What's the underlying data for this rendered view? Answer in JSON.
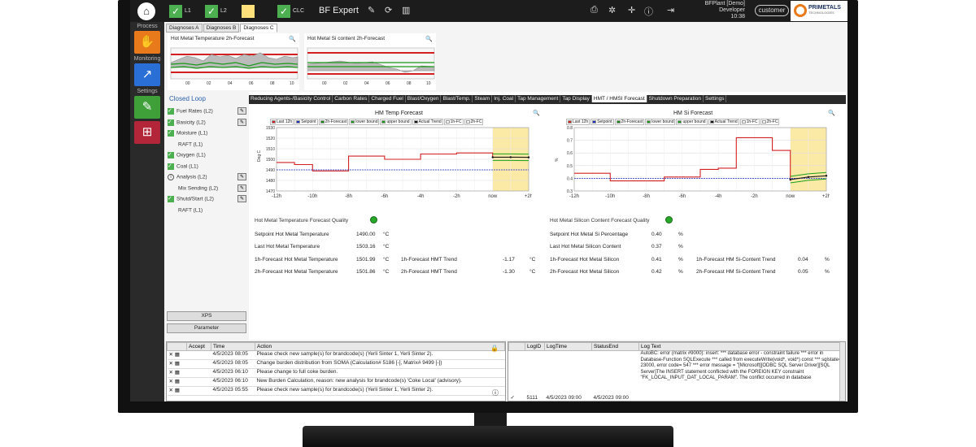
{
  "topbar": {
    "home_icon": "home-icon",
    "checks": [
      {
        "label": "L1"
      },
      {
        "label": "L2"
      },
      {
        "label": ""
      },
      {
        "label": "CLC"
      }
    ],
    "app_title": "BF Expert",
    "user_line1": "BFPlant [Demo]",
    "user_line2": "Developer",
    "time": "10:38",
    "customer": "customer",
    "brand": "PRIMETALS",
    "brand_sub": "TECHNOLOGIES"
  },
  "sidebar": {
    "sections": [
      {
        "label": "Process"
      },
      {
        "label": "Monitoring"
      },
      {
        "label": "Settings"
      }
    ],
    "colors": {
      "process": "#e97a1b",
      "monitoring": "#2a6fd6",
      "settings": "#3fa03a",
      "network": "#b3263a"
    }
  },
  "diag_tabs": [
    "Diagnoses A",
    "Diagnoses B",
    "Diagnoses C"
  ],
  "mini_charts": [
    {
      "title": "Hot Metal Temperature 2h-Forecast",
      "ticks": [
        "00",
        "02",
        "04",
        "06",
        "08",
        "10"
      ]
    },
    {
      "title": "Hot Metal Si content 2h-Forecast",
      "ticks": [
        "00",
        "02",
        "04",
        "06",
        "08",
        "10"
      ]
    }
  ],
  "closed_loop": {
    "title": "Closed Loop",
    "items": [
      {
        "label": "Fuel Rates (L2)",
        "state": "checked",
        "edit": true
      },
      {
        "label": "Basicity (L2)",
        "state": "checked",
        "edit": true
      },
      {
        "label": "Moisture (L1)",
        "state": "checked",
        "edit": false
      },
      {
        "label": "RAFT (L1)",
        "state": "none",
        "edit": false
      },
      {
        "label": "Oxygen (L1)",
        "state": "checked",
        "edit": false
      },
      {
        "label": "Coal (L1)",
        "state": "checked",
        "edit": false
      },
      {
        "label": "Analysis (L2)",
        "state": "info",
        "edit": true
      },
      {
        "label": "Mix Sending (L2)",
        "state": "none",
        "edit": true
      },
      {
        "label": "Shutd/Start (L2)",
        "state": "checked",
        "edit": true
      },
      {
        "label": "RAFT (L1)",
        "state": "none",
        "edit": false
      }
    ],
    "xps_label": "XPS",
    "parameter_label": "Parameter"
  },
  "main_tabs": [
    "Reducing Agents-/Basicity Control",
    "Carbon Rates",
    "Charged Fuel",
    "Blast/Oxygen",
    "Blast/Temp.",
    "Steam",
    "Inj. Coal",
    "Tap Management",
    "Tap Display",
    "HMT / HMSI Forecast",
    "Shutdown Preparation",
    "Settings"
  ],
  "main_tab_active": 9,
  "legend_items": [
    {
      "label": "Last 12h",
      "color": "#d32020"
    },
    {
      "label": "Setpoint",
      "color": "#2030c0"
    },
    {
      "label": "2h-Forecast",
      "color": "#1a8a1a"
    },
    {
      "label": "lower bound",
      "color": "#1aa01a"
    },
    {
      "label": "upper bound",
      "color": "#1aa01a"
    },
    {
      "label": "Actual Trend",
      "color": "#111111"
    },
    {
      "label": "1h-FC",
      "color": "#ffffff"
    },
    {
      "label": "2h-FC",
      "color": "#ffffff"
    }
  ],
  "charts": [
    {
      "title": "HM Temp Forecast",
      "ylabel": "Deg C",
      "yticks": [
        "1530",
        "1520",
        "1510",
        "1500",
        "1490",
        "1480",
        "1470"
      ],
      "xticks": [
        "-12h",
        "-10h",
        "-8h",
        "-6h",
        "-4h",
        "-2h",
        "now",
        "+2h"
      ]
    },
    {
      "title": "HM Si Forecast",
      "ylabel": "%",
      "yticks": [
        "0.8",
        "0.7",
        "0.6",
        "0.5",
        "0.4",
        "0.3"
      ],
      "xticks": [
        "-12h",
        "-10h",
        "-8h",
        "-6h",
        "-4h",
        "-2h",
        "now",
        "+2h"
      ]
    }
  ],
  "chart_data": [
    {
      "type": "line",
      "title": "HM Temp Forecast",
      "ylabel": "Deg C",
      "ylim": [
        1470,
        1530
      ],
      "x": [
        "-12h",
        "-11h",
        "-10h",
        "-9h",
        "-8h",
        "-7h",
        "-6h",
        "-5h",
        "-4h",
        "-3h",
        "-2h",
        "-1h",
        "now",
        "+1h",
        "+2h"
      ],
      "series": [
        {
          "name": "Last 12h",
          "values": [
            1497,
            1495,
            1489,
            1489,
            1503,
            1503,
            1500,
            1500,
            1505,
            1505,
            1506,
            1506,
            1501
          ]
        },
        {
          "name": "Setpoint",
          "values": [
            1490,
            1490,
            1490,
            1490,
            1490,
            1490,
            1490,
            1490,
            1490,
            1490,
            1490,
            1490,
            1490,
            1490,
            1490
          ]
        },
        {
          "name": "2h-Forecast",
          "values": [
            null,
            null,
            null,
            null,
            null,
            null,
            null,
            null,
            null,
            null,
            null,
            null,
            1502,
            1501.99,
            1501.86
          ]
        }
      ]
    },
    {
      "type": "line",
      "title": "HM Si Forecast",
      "ylabel": "%",
      "ylim": [
        0.3,
        0.8
      ],
      "x": [
        "-12h",
        "-11h",
        "-10h",
        "-9h",
        "-8h",
        "-7h",
        "-6h",
        "-5h",
        "-4h",
        "-3h",
        "-2h",
        "-1h",
        "now",
        "+1h",
        "+2h"
      ],
      "series": [
        {
          "name": "Last 12h",
          "values": [
            0.44,
            0.44,
            0.38,
            0.38,
            0.38,
            0.41,
            0.41,
            0.47,
            0.48,
            0.72,
            0.72,
            0.62,
            0.38
          ]
        },
        {
          "name": "Setpoint",
          "values": [
            0.4,
            0.4,
            0.4,
            0.4,
            0.4,
            0.4,
            0.4,
            0.4,
            0.4,
            0.4,
            0.4,
            0.4,
            0.4,
            0.4,
            0.4
          ]
        },
        {
          "name": "2h-Forecast",
          "values": [
            null,
            null,
            null,
            null,
            null,
            null,
            null,
            null,
            null,
            null,
            null,
            null,
            0.39,
            0.41,
            0.42
          ]
        }
      ]
    }
  ],
  "hmt": {
    "quality_label": "Hot Metal Temperature Forecast Quality",
    "rows": [
      {
        "label": "Setpoint Hot Metal Temperature",
        "value": "1490.00",
        "unit": "°C"
      },
      {
        "label": "Last Hot Metal Temperature",
        "value": "1503.16",
        "unit": "°C"
      },
      {
        "label": "1h-Forecast Hot Metal Temperature",
        "value": "1501.99",
        "unit": "°C",
        "trend_label": "1h-Forecast HMT Trend",
        "trend": "-1.17",
        "trend_unit": "°C"
      },
      {
        "label": "2h-Forecast Hot Metal Temperature",
        "value": "1501.86",
        "unit": "°C",
        "trend_label": "2h-Forecast HMT Trend",
        "trend": "-1.30",
        "trend_unit": "°C"
      }
    ]
  },
  "hmsi": {
    "quality_label": "Hot Metal Silicon Content Forecast Quality",
    "rows": [
      {
        "label": "Setpoint Hot Metal Si Percentage",
        "value": "0.40",
        "unit": "%"
      },
      {
        "label": "Last Hot Metal Silicon Content",
        "value": "0.37",
        "unit": "%"
      },
      {
        "label": "1h-Forecast Hot Metal Silicon",
        "value": "0.41",
        "unit": "%",
        "trend_label": "1h-Forecast HM Si-Content Trend",
        "trend": "0.04",
        "trend_unit": "%"
      },
      {
        "label": "2h-Forecast Hot Metal Silicon",
        "value": "0.42",
        "unit": "%",
        "trend_label": "2h-Forecast HM Si-Content Trend",
        "trend": "0.05",
        "trend_unit": "%"
      }
    ]
  },
  "action_log": {
    "headers": [
      "Accept",
      "Time",
      "Action"
    ],
    "rows": [
      {
        "time": "4/5/2023 08:05",
        "action": "Please check new sample(s) for brandcode(s) (Yerli Sinter 1, Yerli Sinter 2)."
      },
      {
        "time": "4/5/2023 08:05",
        "action": "Change burden distribution from SOMA (Calculation# 5186 [-], Matrix# 9499 [-])"
      },
      {
        "time": "4/5/2023 06:10",
        "action": "Please change to full coke burden."
      },
      {
        "time": "4/5/2023 06:10",
        "action": "New Burden Calculation, reason: new analysis for brandcode(s) 'Coke Local' (advisory)."
      },
      {
        "time": "4/5/2023 05:55",
        "action": "Please check new sample(s) for brandcode(s) (Yerli Sinter 1, Yerli Sinter 2)."
      }
    ]
  },
  "db_log": {
    "headers": [
      "LogID",
      "LogTime",
      "StatusEnd",
      "Log Text"
    ],
    "row": {
      "id": "5111",
      "time": "4/5/2023 09:00",
      "status": "4/5/2023 09:00"
    },
    "text": "AutoBC: error (matrix #9000): insert: *** database error - constraint failure *** error in Database-Function SQLExecute *** called from executeWrite(void*, void*) const *** sqlstate= 23000, error code= 547 *** error message = \"[Microsoft][ODBC SQL Server Driver][SQL Server]The INSERT statement conflicted with the FOREIGN KEY constraint \"FK_LOCAL_INPUT_DAT_LOCAL_PARAM\". The conflict occurred in database"
  }
}
